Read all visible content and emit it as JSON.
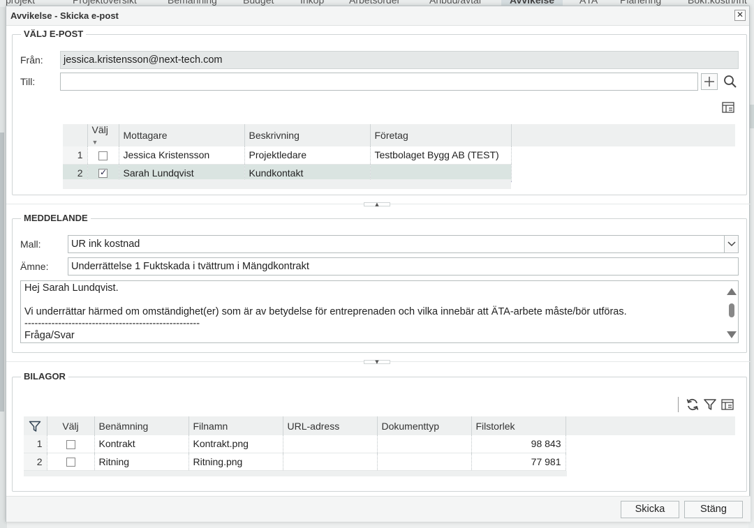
{
  "background": {
    "tabs": [
      "projekt",
      "Projektöversikt",
      "Bemanning",
      "Budget",
      "Inköp",
      "Arbetsorder",
      "Anbud/avtal",
      "Avvikelse",
      "ÄTA",
      "Planering",
      "Bokf.kostn/Int"
    ],
    "active_tab": "Avvikelse"
  },
  "dialog": {
    "title": "Avvikelse - Skicka e-post",
    "close_label": "✕"
  },
  "email": {
    "legend": "VÄLJ E-POST",
    "from_label": "Från:",
    "from_value": "jessica.kristensson@next-tech.com",
    "to_label": "Till:",
    "to_value": "",
    "columns": [
      "",
      "Välj",
      "Mottagare",
      "Beskrivning",
      "Företag"
    ],
    "rows": [
      {
        "num": "1",
        "checked": false,
        "recipient": "Jessica Kristensson",
        "description": "Projektledare",
        "company": "Testbolaget Bygg AB (TEST)"
      },
      {
        "num": "2",
        "checked": true,
        "recipient": "Sarah Lundqvist",
        "description": "Kundkontakt",
        "company": ""
      }
    ]
  },
  "message": {
    "legend": "MEDDELANDE",
    "template_label": "Mall:",
    "template_value": "UR ink kostnad",
    "subject_label": "Ämne:",
    "subject_value": "Underrättelse 1 Fuktskada i tvättrum i Mängdkontrakt",
    "body_lines": [
      "Hej Sarah Lundqvist.",
      "",
      "Vi underrättar härmed om omständighet(er) som är av betydelse för entreprenaden och vilka innebär att ÄTA-arbete måste/bör utföras.",
      "----------------------------------------------------",
      "Fråga/Svar"
    ]
  },
  "attachments": {
    "legend": "BILAGOR",
    "columns": [
      "",
      "Välj",
      "Benämning",
      "Filnamn",
      "URL-adress",
      "Dokumenttyp",
      "Filstorlek"
    ],
    "rows": [
      {
        "num": "1",
        "checked": false,
        "name": "Kontrakt",
        "filename": "Kontrakt.png",
        "url": "",
        "doctype": "",
        "size": "98 843"
      },
      {
        "num": "2",
        "checked": false,
        "name": "Ritning",
        "filename": "Ritning.png",
        "url": "",
        "doctype": "",
        "size": "77 981"
      }
    ]
  },
  "footer": {
    "send_label": "Skicka",
    "close_label": "Stäng"
  },
  "icons": {
    "add": "plus-icon",
    "search": "search-icon",
    "column_settings": "column-settings-icon",
    "refresh": "refresh-icon",
    "filter": "filter-icon",
    "dropdown": "chevron-down-icon"
  }
}
